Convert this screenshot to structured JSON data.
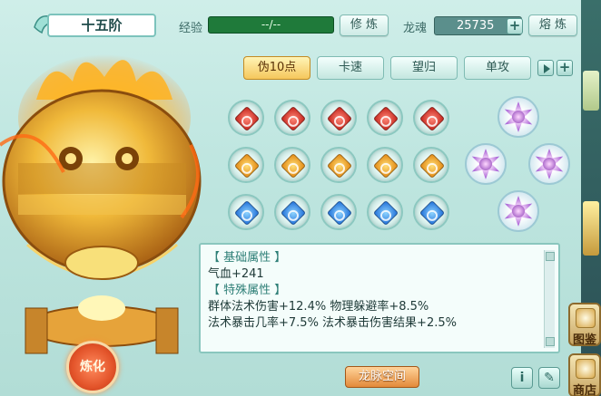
{
  "header": {
    "rank": "十五阶",
    "exp_label": "经验",
    "exp_value": "--/--",
    "cultivate_label": "修 炼",
    "soul_label": "龙魂",
    "soul_value": "25735",
    "smelt_label": "熔 炼"
  },
  "tabs": [
    {
      "label": "伪10点",
      "active": true
    },
    {
      "label": "卡速",
      "active": false
    },
    {
      "label": "望归",
      "active": false
    },
    {
      "label": "单攻",
      "active": false
    }
  ],
  "gems": {
    "rows": [
      [
        "red",
        "red",
        "red",
        "red",
        "red"
      ],
      [
        "orange",
        "orange",
        "orange",
        "orange",
        "orange"
      ],
      [
        "blue",
        "blue",
        "blue",
        "blue",
        "blue"
      ]
    ],
    "star_slots": 4
  },
  "attributes": {
    "basic_header": "【 基础属性 】",
    "basic_lines": [
      "气血+241"
    ],
    "special_header": "【 特殊属性 】",
    "special_lines": [
      "群体法术伤害+12.4%  物理躲避率+8.5%",
      "法术暴击几率+7.5%  法术暴击伤害结果+2.5%"
    ]
  },
  "buttons": {
    "refine": "炼化",
    "dragon_vein_space": "龙脉空间",
    "info": "i"
  },
  "side_buttons": {
    "top": "图鉴",
    "bottom": "商店"
  },
  "colors": {
    "accent_orange": "#e38a3a",
    "exp_green": "#1f7a3a",
    "panel_teal": "#8ac6be"
  }
}
